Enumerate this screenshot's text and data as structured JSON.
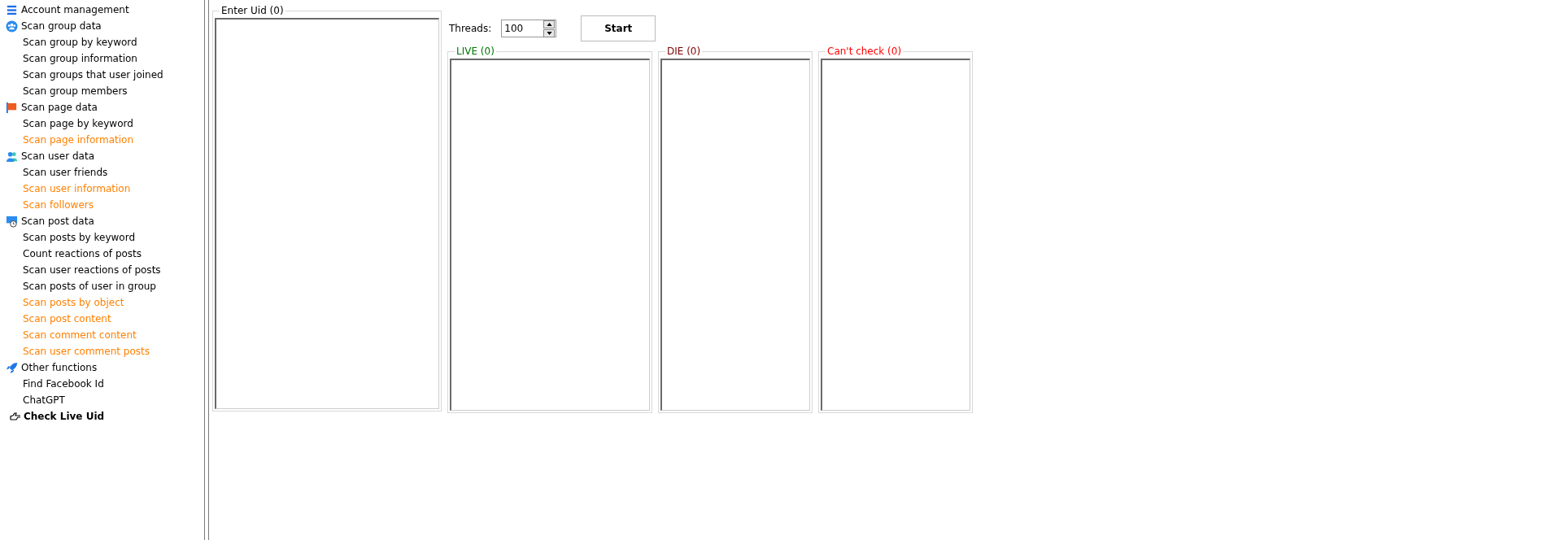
{
  "sidebar": {
    "sections": [
      {
        "title": "Account management"
      },
      {
        "title": "Scan group data",
        "children": [
          {
            "label": "Scan group by keyword",
            "color": "#000000",
            "selected": false
          },
          {
            "label": "Scan group information",
            "color": "#000000",
            "selected": false
          },
          {
            "label": "Scan groups that user joined",
            "color": "#000000",
            "selected": false
          },
          {
            "label": "Scan group members",
            "color": "#000000",
            "selected": false
          }
        ]
      },
      {
        "title": "Scan page data",
        "children": [
          {
            "label": "Scan page by keyword",
            "color": "#000000",
            "selected": false
          },
          {
            "label": "Scan page information",
            "color": "#ff8000",
            "selected": false
          }
        ]
      },
      {
        "title": "Scan user data",
        "children": [
          {
            "label": "Scan user friends",
            "color": "#000000",
            "selected": false
          },
          {
            "label": "Scan user information",
            "color": "#ff8000",
            "selected": false
          },
          {
            "label": "Scan followers",
            "color": "#ff8000",
            "selected": false
          }
        ]
      },
      {
        "title": "Scan post data",
        "children": [
          {
            "label": "Scan posts by keyword",
            "color": "#000000",
            "selected": false
          },
          {
            "label": "Count reactions of posts",
            "color": "#000000",
            "selected": false
          },
          {
            "label": "Scan user reactions of posts",
            "color": "#000000",
            "selected": false
          },
          {
            "label": "Scan posts of user in group",
            "color": "#000000",
            "selected": false
          },
          {
            "label": "Scan posts by object",
            "color": "#ff8000",
            "selected": false
          },
          {
            "label": "Scan post content",
            "color": "#ff8000",
            "selected": false
          },
          {
            "label": "Scan comment content",
            "color": "#ff8000",
            "selected": false
          },
          {
            "label": "Scan user comment posts",
            "color": "#ff8000",
            "selected": false
          }
        ]
      },
      {
        "title": "Other functions",
        "children": [
          {
            "label": "Find Facebook Id",
            "color": "#000000",
            "selected": false
          },
          {
            "label": "ChatGPT",
            "color": "#000000",
            "selected": false
          },
          {
            "label": "Check Live Uid",
            "color": "#000000",
            "selected": true
          }
        ]
      }
    ]
  },
  "input_group": {
    "title": "Enter Uid (0)"
  },
  "threads": {
    "label": "Threads:",
    "value": "100"
  },
  "start_button": "Start",
  "result_groups": [
    {
      "title": "LIVE (0)",
      "color": "#007800"
    },
    {
      "title": "DIE (0)",
      "color": "#800000"
    },
    {
      "title": "Can't check (0)",
      "color": "#ff0000"
    }
  ]
}
